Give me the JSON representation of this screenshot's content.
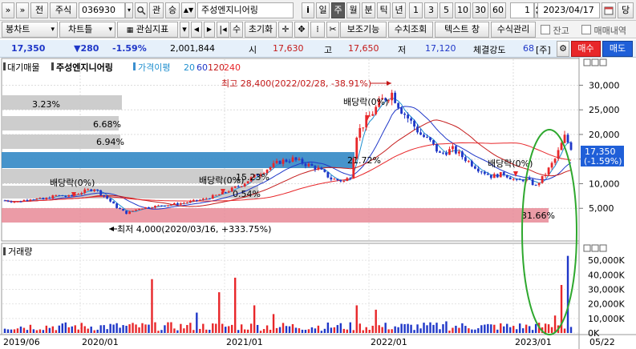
{
  "toolbar": {
    "icon_labels": [
      "»",
      "»"
    ],
    "jeon": "전",
    "market": "주식",
    "code": "036930",
    "gwan": "관",
    "seung": "승",
    "name": "주성엔지니어링",
    "info": "i",
    "periods": [
      "일",
      "주",
      "월",
      "분",
      "틱",
      "년"
    ],
    "selected_period": "주",
    "intervals": [
      "1",
      "3",
      "5",
      "10",
      "30",
      "60"
    ],
    "count": "1",
    "date": "2023/04/17",
    "dang": "당"
  },
  "toolbar2": {
    "bongchart": "봉차트",
    "charttool": "차트틀",
    "indicator": "관심지표",
    "su": "수",
    "reset": "초기화",
    "aux": "보조기능",
    "calc": "수치조회",
    "textwin": "텍스트 창",
    "formula": "수식관리",
    "balance": "잔고",
    "trade": "매매내역"
  },
  "quote": {
    "price": "17,350",
    "change": "▼280",
    "rate": "-1.59%",
    "volume": "2,001,844",
    "open_label": "시",
    "open": "17,630",
    "high_label": "고",
    "high": "17,650",
    "low_label": "저",
    "low": "17,120",
    "strength_label": "체결강도",
    "strength": "68",
    "unit": "[주]",
    "buy": "매수",
    "sell": "매도"
  },
  "price_panel": {
    "header": {
      "title1": "대기매물",
      "title2": "주성엔지니어링",
      "ma_label": "가격이평",
      "ma": [
        "20",
        "60",
        "120",
        "240"
      ]
    },
    "annotations": {
      "high": "최고 28,400(2022/02/28, -38.91%)",
      "low": "최저 4,000(2020/03/16, +333.75%)",
      "dividends": [
        "배당락(0%)",
        "배당락(0%)",
        "배당락(0%)",
        "배당락(0%)"
      ]
    },
    "profile_labels": [
      "3.23%",
      "6.68%",
      "6.94%",
      "21.72%",
      "15.23%",
      "0.54%",
      "31.66%"
    ],
    "current_label": "17,350",
    "current_rate": "(-1.59%)"
  },
  "volume_panel": {
    "title": "거래량",
    "yticks": [
      "50,000K",
      "40,000K",
      "30,000K",
      "20,000K",
      "10,000K",
      "0K"
    ]
  },
  "colors": {
    "up": "#e8272a",
    "down": "#1f37c8",
    "accent": "#3b8fcf"
  },
  "chart_data": {
    "type": "candlestick",
    "x_ticks": [
      "2019/06",
      "2020/01",
      "2021/01",
      "2022/01",
      "2023/01",
      "05/22"
    ],
    "price_y_ticks": [
      "30,000",
      "25,000",
      "20,000",
      "15,000",
      "10,000",
      "5,000"
    ],
    "price_ylim": [
      0,
      33000
    ],
    "price_series": [
      {
        "t": 0,
        "v": 6600
      },
      {
        "t": 4,
        "v": 6300
      },
      {
        "t": 8,
        "v": 7000
      },
      {
        "t": 12,
        "v": 6800
      },
      {
        "t": 16,
        "v": 7600
      },
      {
        "t": 20,
        "v": 7400
      },
      {
        "t": 25,
        "v": 8500
      },
      {
        "t": 28,
        "v": 9000
      },
      {
        "t": 32,
        "v": 7000
      },
      {
        "t": 35,
        "v": 5200
      },
      {
        "t": 38,
        "v": 4000
      },
      {
        "t": 42,
        "v": 5000
      },
      {
        "t": 48,
        "v": 5500
      },
      {
        "t": 55,
        "v": 6000
      },
      {
        "t": 62,
        "v": 6800
      },
      {
        "t": 68,
        "v": 8000
      },
      {
        "t": 74,
        "v": 9800
      },
      {
        "t": 78,
        "v": 11500
      },
      {
        "t": 82,
        "v": 13000
      },
      {
        "t": 86,
        "v": 14500
      },
      {
        "t": 90,
        "v": 15000
      },
      {
        "t": 94,
        "v": 14000
      },
      {
        "t": 98,
        "v": 13000
      },
      {
        "t": 102,
        "v": 11000
      },
      {
        "t": 106,
        "v": 10500
      },
      {
        "t": 108,
        "v": 11500
      },
      {
        "t": 110,
        "v": 20000
      },
      {
        "t": 112,
        "v": 22000
      },
      {
        "t": 115,
        "v": 24500
      },
      {
        "t": 118,
        "v": 27000
      },
      {
        "t": 121,
        "v": 28400
      },
      {
        "t": 124,
        "v": 25000
      },
      {
        "t": 127,
        "v": 22500
      },
      {
        "t": 130,
        "v": 20000
      },
      {
        "t": 133,
        "v": 18500
      },
      {
        "t": 136,
        "v": 16000
      },
      {
        "t": 140,
        "v": 17000
      },
      {
        "t": 144,
        "v": 15000
      },
      {
        "t": 148,
        "v": 13000
      },
      {
        "t": 152,
        "v": 11500
      },
      {
        "t": 156,
        "v": 12000
      },
      {
        "t": 160,
        "v": 10500
      },
      {
        "t": 163,
        "v": 11000
      },
      {
        "t": 166,
        "v": 9500
      },
      {
        "t": 169,
        "v": 12000
      },
      {
        "t": 172,
        "v": 15000
      },
      {
        "t": 175,
        "v": 19500
      },
      {
        "t": 177,
        "v": 17350
      }
    ],
    "volume_ylim": [
      0,
      55000
    ],
    "volume_spikes": [
      {
        "t": 46,
        "v": 37000
      },
      {
        "t": 60,
        "v": 14000
      },
      {
        "t": 67,
        "v": 28000
      },
      {
        "t": 72,
        "v": 38000
      },
      {
        "t": 78,
        "v": 19000
      },
      {
        "t": 84,
        "v": 13000
      },
      {
        "t": 110,
        "v": 19000
      },
      {
        "t": 116,
        "v": 16000
      },
      {
        "t": 138,
        "v": 8000
      },
      {
        "t": 170,
        "v": 6000
      },
      {
        "t": 172,
        "v": 12000
      },
      {
        "t": 174,
        "v": 33000
      },
      {
        "t": 176,
        "v": 53000
      }
    ]
  }
}
